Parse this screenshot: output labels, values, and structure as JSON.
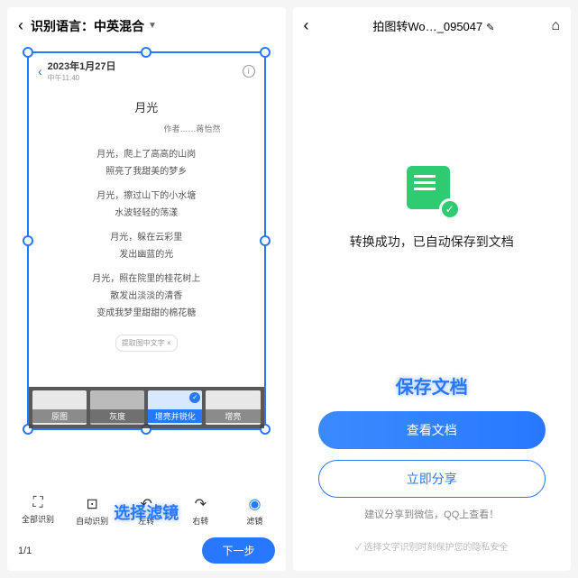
{
  "left": {
    "lang_label": "识别语言：",
    "lang_value": "中英混合",
    "doc": {
      "date": "2023年1月27日",
      "time": "中午11:40",
      "title": "月光",
      "author": "作者……蒋怡然",
      "lines": [
        "月光，爬上了高高的山岗",
        "照亮了我甜美的梦乡",
        "月光，擦过山下的小水塘",
        "水波轻轻的荡漾",
        "月光，躲在云彩里",
        "发出幽蓝的光",
        "月光，照在院里的桂花树上",
        "散发出淡淡的清香",
        "变成我梦里甜甜的棉花糖"
      ],
      "tag": "提取图中文字 ×"
    },
    "filters": [
      "原图",
      "灰度",
      "增亮并锐化",
      "增亮"
    ],
    "filter_selected_index": 2,
    "tools": {
      "all": "全部识别",
      "auto": "自动识别",
      "left": "左转",
      "right": "右转",
      "filter": "滤镜"
    },
    "callout": "选择滤镜",
    "page": "1/1",
    "next": "下一步"
  },
  "right": {
    "title": "拍图转Wo…_095047",
    "success_text": "转换成功，已自动保存到文档",
    "callout": "保存文档",
    "view_btn": "查看文档",
    "share_btn": "立即分享",
    "hint": "建议分享到微信，QQ上查看！",
    "privacy": "选择文字识别时刻保护您的隐私安全"
  }
}
